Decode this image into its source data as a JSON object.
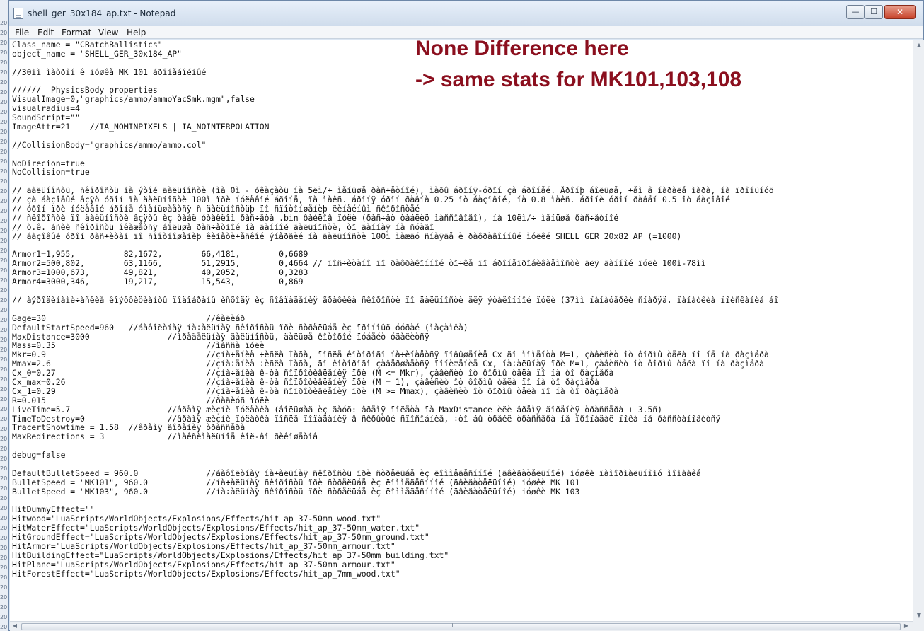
{
  "background_window": {
    "line_numbers": [
      "20",
      "20",
      "20",
      "20",
      "20",
      "20",
      "20",
      "20",
      "20",
      "20",
      "20",
      "20",
      "20",
      "20",
      "20",
      "20",
      "20",
      "20",
      "20",
      "20",
      "20",
      "20",
      "20",
      "20",
      "20",
      "20",
      "20",
      "20",
      "20",
      "20",
      "20",
      "20",
      "20",
      "20",
      "20",
      "20",
      "20",
      "20",
      "20",
      "20",
      "20",
      "20",
      "20",
      "20",
      "20",
      "20",
      "20",
      "20",
      "20",
      "20",
      "20",
      "20",
      "20",
      "20",
      "20",
      "20",
      "20",
      "20",
      "20",
      "20",
      "20",
      "20",
      "20"
    ]
  },
  "window": {
    "title": "shell_ger_30x184_ap.txt - Notepad",
    "controls": {
      "minimize": "—",
      "maximize": "☐",
      "close": "✕"
    }
  },
  "menu": [
    "File",
    "Edit",
    "Format",
    "View",
    "Help"
  ],
  "annotation": {
    "line1": "None Difference here",
    "line2": "-> same stats for MK101,103,108"
  },
  "document": {
    "lines": [
      "Class_name = \"CBatchBallistics\"",
      "object_name = \"SHELL_GER_30x184_AP\"",
      "",
      "//30ìì ìàòðîí ê ióøêå MK 101 áðîíåáîéíûé",
      "",
      "//////  PhysicsBody properties",
      "VisualImage=0,\"graphics/ammo/ammoYacSmk.mgm\",false",
      "visualradius=4",
      "SoundScript=\"\"",
      "ImageAttr=21    //IA_NOMINPIXELS | IA_NOINTERPOLATION",
      "",
      "//CollisionBody=\"graphics/ammo/ammo.col\"",
      "",
      "NoDirecion=true",
      "NoCollision=true",
      "",
      "// äàëüíîñòü, ñêîðîñòü íà ýòîé äàëüíîñòè (ìà 0ì - óêàçàòü íà 5ëì/÷ ìåíüøå ðàñ÷åòíîé), ìàõû áðîíÿ-óðîí çà áðîíåé. Äðîíþ áîëüøå, ÷åì â íàðàëå ìàðà, íà ïðîíüíóö",
      "// çà áàçîâûé âçÿò óðîí ïà äàëüíîñòè 100ì ïðè íóëåâîé áðîíå, ïà ìàêñ. áðîíÿ óðîí ðàâíà 0.25 îò áàçîâîé, íà 0.8 ìàêñ. áðîíè óðîí ðàâåí 0.5 îò áàçîâîé",
      "// óðîí ïðè íóëåâîé áðîíå óìåíüøàåòñÿ ñ äàëüíîñòüþ ïî ñïîòîíøåíèþ ëèíåéíûì ñêîðîñòåé",
      "// ñêîðîñòè ïî äàëüíîñòè âçÿòû èç òàáë óòåêëîì ðàñ÷åòà .bin ôàéëîâ ïóëè (ðàñ÷åò òàáëèö ìàññîâîãî), íà 10ëì/÷ ìåíüøå ðàñ÷åòíîé",
      "// ò.ê. áñèè ñêîðîñòü îêàæåòñÿ áîëüøå ðàñ÷åòíîé íà äàííîé äàëüíîñòè, òî äàííàÿ íà ñóàãî",
      "// áàçîâûé óðîí ðàñ÷èòàí ïî ñîîòíîøåíèþ êèíåòè÷åñêîé ýíåðãèé íà äàëüíîñòè 100ì ìàæäó ñíàÿäå è ðàôðàâîííûé ìóëêé SHELL_GER_20x82_AP (=1000)",
      "",
      "Armor1=1,955,          82,1672,        66,4181,        0,6689",
      "Armor2=500,802,        63,1166,        51,2915,        0,4664 // ïîñ÷èòàíî ïî ðàôðàêîííîé òî÷êå ïî áðîíåïðîáèâàåìîñòè äëÿ äàííîé ïóëè 100ì-78ìì",
      "Armor3=1000,673,       49,821,         40,2052,        0,3283",
      "Armor4=3000,346,       19,217,         15,543,         0,869",
      "",
      "// àýðîäèíàìè÷åñêèå êîýôôèöèåíòû ïîäîáðàíû èñõîäÿ èç ñîâïàäåíèÿ ãðàôèêà ñêîðîñòè ïî äàëüíîñòè äëÿ ýòàëîííîé ïóëè (37ìì ïàíàóåðêè ñíàðÿä, ïàíàòêèà ïîèñêàíèå áî",
      "",
      "Gage=30                                 //êàëèáð",
      "DefaultStartSpeed=960   //áàôîëòíàÿ íà÷àëüíàÿ ñêîðîñòü ïðè ñòðåëüáå èç ïðîíîûõ óóðàé (ìàçàìêà)",
      "MaxDistance=3000                //ìðåäåëüíàÿ äàëüíîñòü, äàëüøå êîòîðîé ïóáåéò óäàëèòñÿ",
      "Mass=0.35                               //ìàññà ïóëè",
      "Mkr=0.9                                 //çíà÷åíèå ÷èñëà Ìàõà, ïîñëå êîòîðîãî íà÷èíàåòñÿ ïîâûøåíèå Cx äî ìîìåíòà M=1, çàâèñèò îò ôîðìû òåëà ïî íå íà ðàçìåðà",
      "Mmax=2.6                                //çíà÷åíèå ÷èñëà Ìàõà, äî êîòîðîãî çàâåðøàåòñÿ ïîíèæåíèå Cx, íà÷àëüíàÿ ïðè M=1, çàâèñèò îò ôîðìû òåëà ïî íà ðàçìåðà",
      "Cx_0=0.27                               //çíà÷åíèå ê-òà ñîïðîòèâëåíèÿ ïðè (M <= Mkr), çàâèñèò îò ôîðìû òåëà ïî íà òî ðàçìåðà",
      "Cx_max=0.26                             //çíà÷åíèå ê-òà ñîïðîòèâëåíèÿ ïðè (M = 1), çàâèñèò îò ôîðìû òåëà ïî íà òî ðàçìåðà",
      "Cx_1=0.29                               //çíà÷åíèå ê-òà ñîïðîòèâëåíèÿ ïðè (M >= Mmax), çàâèñèò îò ôîðìû òåëà ïî íà òî ðàçìåðà",
      "R=0.015                                 //ðàäèóñ ïóëè",
      "LiveTime=5.7                    //âðåìÿ æèçíè ïóëåòêà (âîëüøàä èç äàóõ: âðåìÿ ïîëåòà ïà MaxDistance èëè âðåìÿ ãîðåíèÿ òðàññåðà + 3.5ñ)",
      "TimeToDestroy=0                 //âðåìÿ æèçíè ïóëåòêà ïîñëå ïîïàäàíèÿ â ñêðûòûé ñïîñîáíèå, ÷òî áû òðåéë òðàññåðà íå ïðîïàäàë ïîêà íå ðàññòàíîâèòñÿ",
      "TracertShowtime = 1.58  //âðåìÿ ãîðåíèÿ òðàññåðà",
      "MaxRedirections = 3             //ìàêñèìàëüíîå êîë-âî ðèêîøåòîâ",
      "",
      "debug=false",
      "",
      "DefaultBulletSpeed = 960.0              //áàôîëòíàÿ íà÷àëüíàÿ ñêîðîñòü ïðè ñòðåëüáå èç ëîììåäåñííîé (äâèãàòåëüíîé) ióøêè ïàìîðìàëüíîìó ìîìààêå",
      "BulletSpeed = \"MK101\", 960.0            //íà÷àëüíàÿ ñêîðîñòü ïðè ñòðåëüáå èç ëîììåäåñííîé (äâèãàòåëüíîé) ióøêè MK 101",
      "BulletSpeed = \"MK103\", 960.0            //íà÷àëüíàÿ ñêîðîñòü ïðè ñòðåëüáå èç ëîììåäåñííîé (äâèãàòåëüíîé) ióøêè MK 103",
      "",
      "HitDummyEffect=\"\"",
      "Hitwood=\"LuaScripts/WorldObjects/Explosions/Effects/hit_ap_37-50mm_wood.txt\"",
      "HitWaterEffect=\"LuaScripts/WorldObjects/Explosions/Effects/hit_ap_37-50mm_water.txt\"",
      "HitGroundEffect=\"LuaScripts/WorldObjects/Explosions/Effects/hit_ap_37-50mm_ground.txt\"",
      "HitArmor=\"LuaScripts/WorldObjects/Explosions/Effects/hit_ap_37-50mm_armour.txt\"",
      "HitBuildingEffect=\"LuaScripts/WorldObjects/Explosions/Effects/hit_ap_37-50mm_building.txt\"",
      "HitPlane=\"LuaScripts/WorldObjects/Explosions/Effects/hit_ap_37-50mm_armour.txt\"",
      "HitForestEffect=\"LuaScripts/WorldObjects/Explosions/Effects/hit_ap_7mm_wood.txt\""
    ]
  },
  "scrollbars": {
    "up": "▲",
    "down": "▼",
    "left": "◀",
    "right": "▶"
  }
}
